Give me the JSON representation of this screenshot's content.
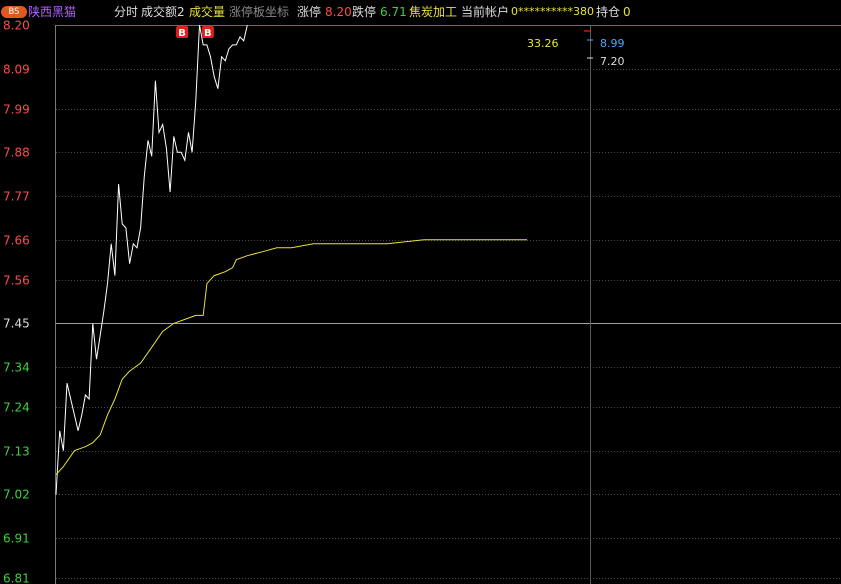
{
  "header": {
    "badge": "BS",
    "stock_name": "陕西黑猫",
    "tab_timeshare": "分时",
    "tab_turnover": "成交额2",
    "tab_volume": "成交量",
    "tab_limit_coord": "涨停板坐标",
    "limit_up_label": "涨停",
    "limit_up_value": "8.20",
    "limit_down_label": "跌停",
    "limit_down_value": "6.71",
    "sector": "焦炭加工",
    "account_label": "当前帐户",
    "account_value": "0**********380",
    "position_label": "持仓",
    "position_value": "0"
  },
  "side_values": {
    "volume": "33.26",
    "price_high": "8.99",
    "price_low": "7.20"
  },
  "colors": {
    "price_line": "#ffffff",
    "avg_line": "#e8e23a",
    "axis_up": "#ff4a4a",
    "axis_down": "#3ccf3c",
    "grid": "#4a4a4a",
    "grid_mid": "#a0a0a0",
    "limit_line": "#ff3030",
    "buy_marker": "#e02020"
  },
  "chart_data": {
    "type": "line",
    "title": "",
    "xlabel": "",
    "ylabel": "",
    "ylim": [
      6.81,
      8.2
    ],
    "y_ticks": [
      "8.20",
      "8.09",
      "7.99",
      "7.88",
      "7.77",
      "7.66",
      "7.56",
      "7.45",
      "7.34",
      "7.24",
      "7.13",
      "7.02",
      "6.91",
      "6.81"
    ],
    "prev_close": 7.45,
    "markers": [
      {
        "label": "B",
        "x": 34,
        "y": 8.2
      },
      {
        "label": "B",
        "x": 41,
        "y": 8.2
      }
    ],
    "series": [
      {
        "values": [
          [
            0,
            7.02
          ],
          [
            1,
            7.18
          ],
          [
            2,
            7.13
          ],
          [
            3,
            7.3
          ],
          [
            4,
            7.26
          ],
          [
            5,
            7.22
          ],
          [
            6,
            7.18
          ],
          [
            7,
            7.22
          ],
          [
            8,
            7.27
          ],
          [
            9,
            7.26
          ],
          [
            10,
            7.45
          ],
          [
            11,
            7.36
          ],
          [
            12,
            7.42
          ],
          [
            13,
            7.48
          ],
          [
            14,
            7.55
          ],
          [
            15,
            7.65
          ],
          [
            16,
            7.57
          ],
          [
            17,
            7.8
          ],
          [
            18,
            7.7
          ],
          [
            19,
            7.69
          ],
          [
            20,
            7.6
          ],
          [
            21,
            7.65
          ],
          [
            22,
            7.64
          ],
          [
            23,
            7.69
          ],
          [
            24,
            7.82
          ],
          [
            25,
            7.91
          ],
          [
            26,
            7.87
          ],
          [
            27,
            8.06
          ],
          [
            28,
            7.93
          ],
          [
            29,
            7.95
          ],
          [
            30,
            7.89
          ],
          [
            31,
            7.78
          ],
          [
            32,
            7.92
          ],
          [
            33,
            7.88
          ],
          [
            34,
            7.88
          ],
          [
            35,
            7.86
          ],
          [
            36,
            7.93
          ],
          [
            37,
            7.88
          ],
          [
            38,
            8.01
          ],
          [
            39,
            8.2
          ],
          [
            40,
            8.15
          ],
          [
            41,
            8.15
          ],
          [
            42,
            8.12
          ],
          [
            43,
            8.07
          ],
          [
            44,
            8.04
          ],
          [
            45,
            8.12
          ],
          [
            46,
            8.11
          ],
          [
            47,
            8.14
          ],
          [
            48,
            8.15
          ],
          [
            49,
            8.15
          ],
          [
            50,
            8.17
          ],
          [
            51,
            8.16
          ],
          [
            52,
            8.2
          ]
        ]
      },
      {
        "values": [
          [
            0,
            7.07
          ],
          [
            2,
            7.09
          ],
          [
            5,
            7.13
          ],
          [
            8,
            7.14
          ],
          [
            10,
            7.15
          ],
          [
            12,
            7.17
          ],
          [
            14,
            7.22
          ],
          [
            16,
            7.26
          ],
          [
            18,
            7.31
          ],
          [
            20,
            7.33
          ],
          [
            23,
            7.35
          ],
          [
            26,
            7.39
          ],
          [
            29,
            7.43
          ],
          [
            32,
            7.45
          ],
          [
            35,
            7.46
          ],
          [
            38,
            7.47
          ],
          [
            40,
            7.47
          ],
          [
            41,
            7.55
          ],
          [
            43,
            7.57
          ],
          [
            46,
            7.58
          ],
          [
            48,
            7.59
          ],
          [
            49,
            7.61
          ],
          [
            52,
            7.62
          ],
          [
            56,
            7.63
          ],
          [
            60,
            7.64
          ],
          [
            64,
            7.64
          ],
          [
            70,
            7.65
          ],
          [
            80,
            7.65
          ],
          [
            90,
            7.65
          ],
          [
            100,
            7.66
          ],
          [
            115,
            7.66
          ],
          [
            128,
            7.66
          ]
        ]
      }
    ],
    "x_range": [
      0,
      240
    ]
  }
}
